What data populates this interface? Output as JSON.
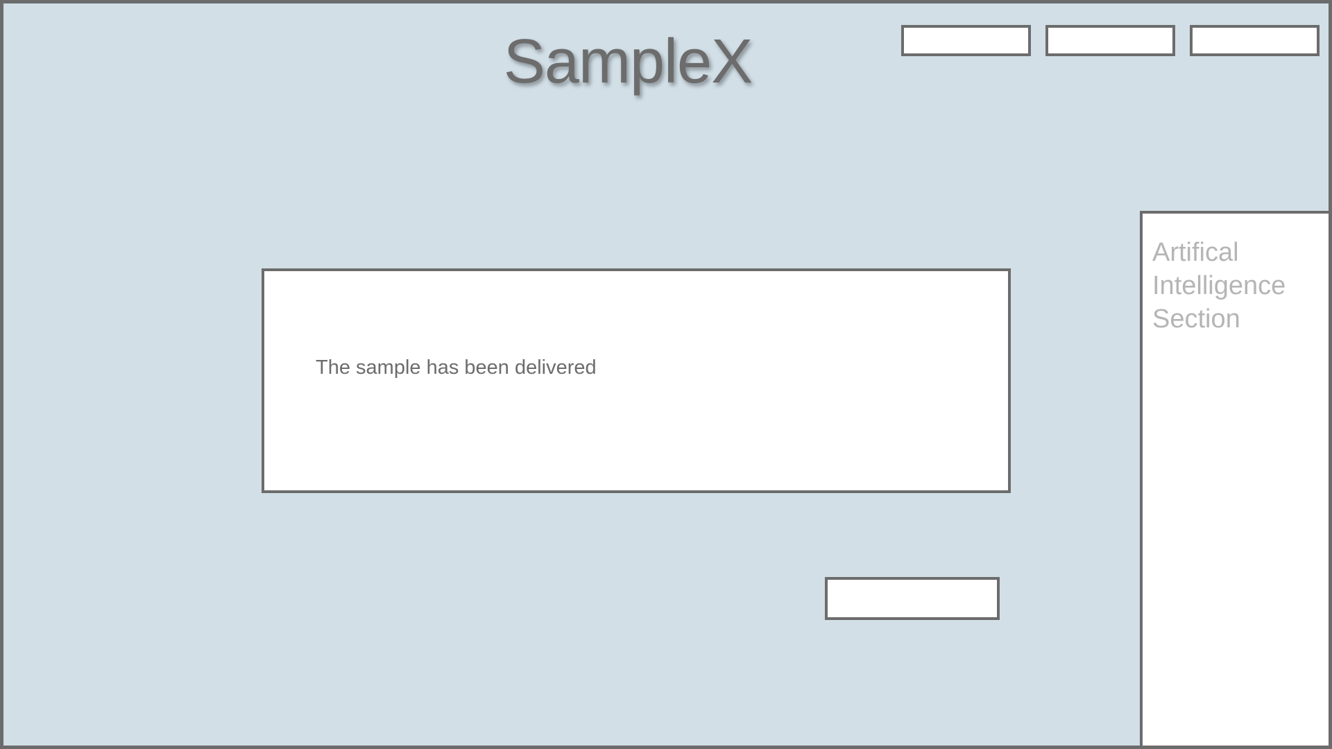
{
  "header": {
    "title": "SampleX",
    "nav_buttons": [
      {
        "label": ""
      },
      {
        "label": ""
      },
      {
        "label": ""
      }
    ]
  },
  "main": {
    "message": "The sample has been delivered",
    "action_button": {
      "label": ""
    }
  },
  "ai_panel": {
    "title_lines": [
      "Artifical",
      "Intelligence",
      "Section"
    ]
  },
  "colors": {
    "background": "#d2dfe7",
    "border": "#6c6c6c",
    "panel": "#ffffff",
    "title_text": "#6c6c6c",
    "muted_text": "#b5b5b5"
  }
}
